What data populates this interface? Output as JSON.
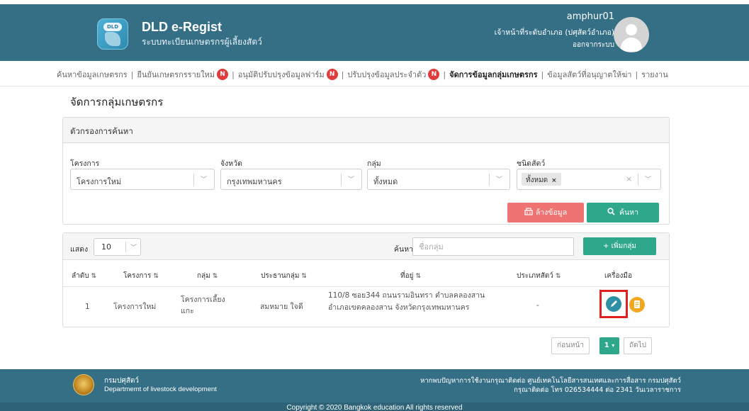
{
  "header": {
    "logo_text": "DLD",
    "app_title": "DLD e-Regist",
    "app_subtitle": "ระบบทะเบียนเกษตรกรผู้เลี้ยงสัตว์",
    "user_name": "amphur01",
    "user_role": "เจ้าหน้าที่ระดับอำเภอ (ปศุสัตว์อำเภอ)",
    "logout_label": "ออกจากระบบ"
  },
  "nav": {
    "items": [
      {
        "label": "ค้นหาข้อมูลเกษตรกร",
        "badge": ""
      },
      {
        "label": "ยืนยันเกษตรกรรายใหม่",
        "badge": "N"
      },
      {
        "label": "อนุมัติปรับปรุงข้อมูลฟาร์ม",
        "badge": "N"
      },
      {
        "label": "ปรับปรุงข้อมูลประจำตัว",
        "badge": "N"
      },
      {
        "label": "จัดการข้อมูลกลุ่มเกษตรกร",
        "badge": "",
        "active": true
      },
      {
        "label": "ข้อมูลสัตว์ที่อนุญาตให้ฆ่า",
        "badge": ""
      },
      {
        "label": "รายงาน",
        "badge": ""
      }
    ]
  },
  "page_title": "จัดการกลุ่มเกษตรกร",
  "filter": {
    "title": "ตัวกรองการค้นหา",
    "fields": [
      {
        "label": "โครงการ",
        "value": "โครงการใหม่"
      },
      {
        "label": "จังหวัด",
        "value": "กรุงเทพมหานคร"
      },
      {
        "label": "กลุ่ม",
        "value": "ทั้งหมด"
      },
      {
        "label": "ชนิดสัตว์",
        "tag": "ทั้งหมด"
      }
    ],
    "clear_label": "ล้างข้อมูล",
    "search_label": "ค้นหา"
  },
  "table": {
    "show_label": "แสดง",
    "page_size": "10",
    "search_label": "ค้นหา :",
    "search_placeholder": "ชื่อกลุ่ม",
    "add_label": "+ เพิ่มกลุ่ม",
    "columns": [
      "ลำดับ",
      "โครงการ",
      "กลุ่ม",
      "ประธานกลุ่ม",
      "ที่อยู่",
      "ประเภทสัตว์",
      "เครื่องมือ"
    ],
    "rows": [
      {
        "index": "1",
        "project": "โครงการใหม่",
        "group_line1": "โครงการเลี้ยง",
        "group_line2": "แกะ",
        "chairman": "สมหมาย ใจดี",
        "address_line1": "110/8 ซอย344 ถนนรามอินทรา ตำบลคลองสาน",
        "address_line2": "อำเภอเขตคลองสาน จังหวัดกรุงเทพมหานคร",
        "animal_type": "-"
      }
    ]
  },
  "pagination": {
    "prev_label": "ก่อนหน้า",
    "current_page": "1",
    "next_label": "ถัดไป"
  },
  "footer": {
    "dept_th": "กรมปศุสัตว์",
    "dept_en": "Departmemt of livestock development",
    "contact_line1": "หากพบปัญหาการใช้งานกรุณาติดต่อ ศูนย์เทคโนโลยีสารสนเทศและการสื่อสาร กรมปศุสัตว์",
    "contact_line2": "กรุณาติดต่อ โทร 026534444 ต่อ 2341 วันเวลาราชการ",
    "copyright": "Copyright © 2020 Bangkok education All rights reserved"
  },
  "colors": {
    "header_bg": "#356f86",
    "accent_green": "#2ea78b",
    "clear_red": "#f07373",
    "badge_red": "#e03c3c",
    "edit_blue": "#2f8fa4",
    "doc_orange": "#f2a81e",
    "highlight_red": "#e01f1f"
  },
  "icons": {
    "edit": "pencil-icon",
    "document": "document-icon",
    "search": "search-icon",
    "clear": "eraser-icon",
    "avatar": "user-avatar-icon"
  }
}
